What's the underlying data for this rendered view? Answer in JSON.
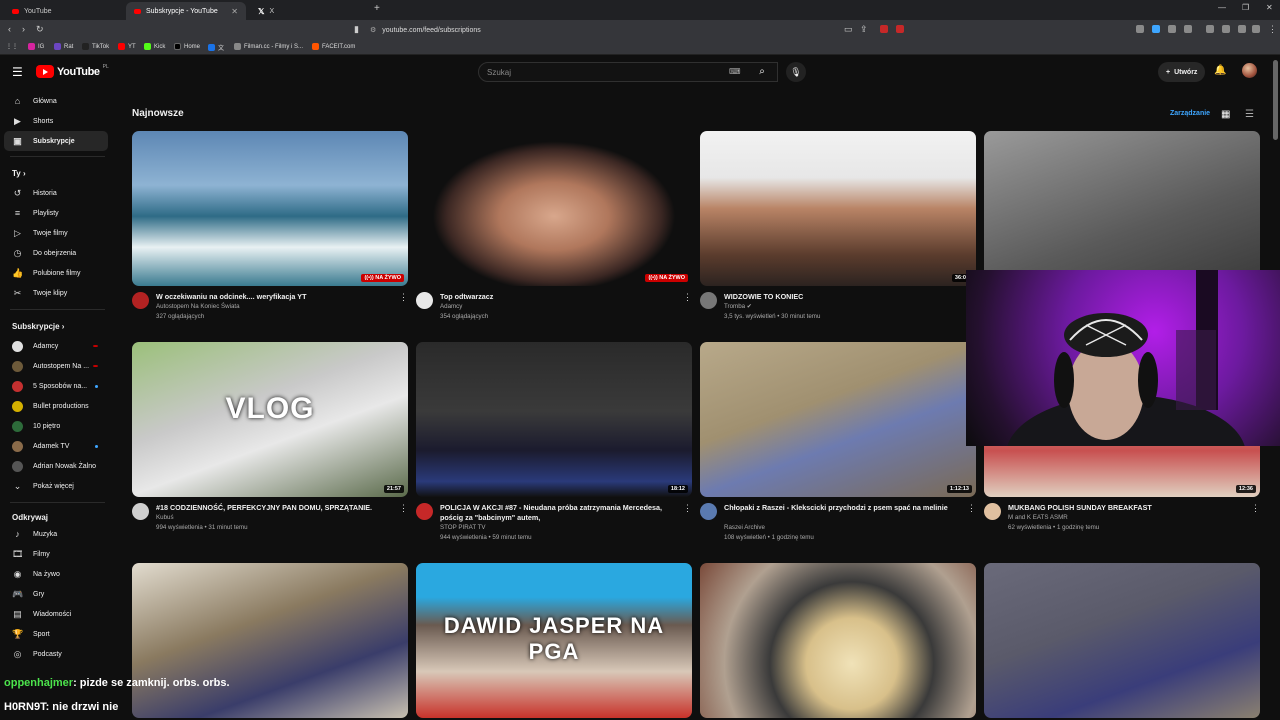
{
  "browser": {
    "tabs": [
      {
        "title": "YouTube",
        "icon": "youtube-icon"
      },
      {
        "title": "Subskrypcje - YouTube",
        "icon": "youtube-icon",
        "active": true
      },
      {
        "title": "X",
        "icon": "x-icon"
      }
    ],
    "url": "youtube.com/feed/subscriptions",
    "bookmarks": [
      {
        "label": "IG",
        "color": "#d6249f"
      },
      {
        "label": "Rat",
        "color": "#6b46c1"
      },
      {
        "label": "TikTok",
        "color": "#111111"
      },
      {
        "label": "YT",
        "color": "#ff0000"
      },
      {
        "label": "Kick",
        "color": "#53fc18"
      },
      {
        "label": "Home",
        "color": "#000000"
      },
      {
        "label": "文",
        "color": "#1a73e8"
      },
      {
        "label": "Filman.cc - Filmy i S...",
        "color": "#888888"
      },
      {
        "label": "FACEIT.com",
        "color": "#ff5500"
      }
    ]
  },
  "header": {
    "logo": "YouTube",
    "logo_country": "PL",
    "search_placeholder": "Szukaj",
    "create_label": "Utwórz"
  },
  "sidebar": {
    "main": [
      {
        "label": "Główna",
        "icon": "home-icon"
      },
      {
        "label": "Shorts",
        "icon": "shorts-icon"
      },
      {
        "label": "Subskrypcje",
        "icon": "subscriptions-icon",
        "active": true
      }
    ],
    "you_header": "Ty",
    "you": [
      {
        "label": "Historia",
        "icon": "history-icon"
      },
      {
        "label": "Playlisty",
        "icon": "playlist-icon"
      },
      {
        "label": "Twoje filmy",
        "icon": "your-videos-icon"
      },
      {
        "label": "Do obejrzenia",
        "icon": "watch-later-icon"
      },
      {
        "label": "Polubione filmy",
        "icon": "like-icon"
      },
      {
        "label": "Twoje klipy",
        "icon": "clips-icon"
      }
    ],
    "subs_header": "Subskrypcje",
    "subs": [
      {
        "label": "Adamcy",
        "color": "#e0e0e0",
        "live": true
      },
      {
        "label": "Autostopem Na ...",
        "color": "#6d5a3a",
        "live": true
      },
      {
        "label": "5 Sposobów na...",
        "color": "#c43030",
        "dot": true
      },
      {
        "label": "Bullet productions",
        "color": "#d4b000"
      },
      {
        "label": "10 piętro",
        "color": "#2d6b3a"
      },
      {
        "label": "Adamek TV",
        "color": "#8a6b4a",
        "dot": true
      },
      {
        "label": "Adrian Nowak Żalno",
        "color": "#555555"
      }
    ],
    "show_more": "Pokaż więcej",
    "explore_header": "Odkrywaj",
    "explore": [
      {
        "label": "Muzyka",
        "icon": "music-icon"
      },
      {
        "label": "Filmy",
        "icon": "film-icon"
      },
      {
        "label": "Na żywo",
        "icon": "live-icon"
      },
      {
        "label": "Gry",
        "icon": "gaming-icon"
      },
      {
        "label": "Wiadomości",
        "icon": "news-icon"
      },
      {
        "label": "Sport",
        "icon": "trophy-icon"
      },
      {
        "label": "Podcasty",
        "icon": "podcast-icon"
      }
    ]
  },
  "main": {
    "section_title": "Najnowsze",
    "manage_label": "Zarządzanie",
    "videos": [
      {
        "title": "W oczekiwaniu na odcinek.... weryfikacja YT",
        "channel": "Autostopem Na Koniec Świata",
        "stats": "327 oglądających",
        "badge": "NA ŻYWO",
        "live": true,
        "thumb": "linear-gradient(180deg,#5d87b4 0%,#8eb3d3 35%,#2e6b86 55%,#e9f1f3 75%,#3a7a8f 100%)",
        "avatar": "#b22222"
      },
      {
        "title": "Top odtwarzacz",
        "channel": "Adamcy",
        "stats": "354 oglądających",
        "badge": "NA ŻYWO",
        "live": true,
        "thumb": "radial-gradient(ellipse at 50% 55%,#d8a78c 0%,#b0775c 28%,#3b2723 55%,#0f0f0f 62%)",
        "avatar": "#e8e8e8"
      },
      {
        "title": "WIDZOWIE TO KONIEC",
        "channel": "Tromba",
        "stats": "3,5 tys. wyświetleń • 30 minut temu",
        "badge": "36:08",
        "verified": true,
        "thumb": "linear-gradient(180deg,#f2f2f2 0%,#e7e7e7 30%,#b98466 50%,#5b3c2d 80%,#2c2320 100%)",
        "avatar": "#777777"
      },
      {
        "title": "",
        "channel": "",
        "stats": "",
        "badge": "",
        "thumb": "linear-gradient(160deg,#9a9a9a,#5a5a5a 60%,#3a3a3a)",
        "avatar": "#444444"
      },
      {
        "title": "#18 CODZIENNOŚĆ, PERFEKCYJNY PAN DOMU, SPRZĄTANIE.",
        "channel": "Kubuś",
        "stats": "994 wyświetlenia • 31 minut temu",
        "badge": "21:57",
        "overlay": "VLOG",
        "thumb": "linear-gradient(160deg,#9bc07a 0%,#c9c9c9 40%,#e8e8e8 60%,#5a6a4a 100%)",
        "avatar": "#cfcfcf"
      },
      {
        "title": "POLICJA W AKCJI #87 - Nieudana próba zatrzymania Mercedesa, pościg za \"babcinym\" autem,",
        "channel": "STOP PIRAT TV",
        "stats": "944 wyświetlenia • 59 minut temu",
        "badge": "18:12",
        "thumb": "linear-gradient(180deg,#2a2a2a 0%,#3a3a3a 45%,#1b1b2e 70%,#2a3a7a 90%,#111 100%)",
        "avatar": "#c62828"
      },
      {
        "title": "Chłopaki z Raszei - Klekscicki przychodzi z psem spać na melinie",
        "channel": "Raszei Archive",
        "stats": "108 wyświetleń • 1 godzinę temu",
        "badge": "1:12:13",
        "thumb": "linear-gradient(160deg,#b8a98a 0%,#a09070 40%,#6d7bb0 60%,#7a6a55 100%)",
        "avatar": "#5a7ab0"
      },
      {
        "title": "MUKBANG POLISH SUNDAY BREAKFAST",
        "channel": "M and K EATS ASMR",
        "stats": "62 wyświetlenia • 1 godzinę temu",
        "badge": "12:36",
        "thumb": "linear-gradient(180deg,#d8c2a0 0%,#e8b0a0 40%,#c85050 70%,#e0d0c0 100%)",
        "avatar": "#e0c0a0"
      },
      {
        "title": "",
        "channel": "",
        "stats": "",
        "badge": "",
        "thumb": "linear-gradient(160deg,#e2dccf 0%,#8a7a60 40%,#3a3d6a 70%,#c8c0b0 100%)",
        "avatar": "#444"
      },
      {
        "title": "",
        "channel": "",
        "stats": "",
        "badge": "",
        "overlay": "DAWID JASPER NA PGA",
        "thumb": "linear-gradient(180deg,#2aa8e0 0%,#2aa8e0 22%,#6a5a50 40%,#d8c8b8 70%,#c8322a 100%)",
        "avatar": "#444"
      },
      {
        "title": "",
        "channel": "",
        "stats": "",
        "badge": "",
        "thumb": "radial-gradient(circle at 55% 65%,#f0e2b8 0%,#d8c08a 25%,#3a3a3a 45%,#b0a090 70%,#7a4a3a 100%)",
        "avatar": "#444"
      },
      {
        "title": "",
        "channel": "",
        "stats": "",
        "badge": "",
        "thumb": "linear-gradient(160deg,#6a6a7a 0%,#5a5a6a 40%,#3a3d7a 70%,#8a8070 100%)",
        "avatar": "#444"
      }
    ]
  },
  "stream": {
    "chat": [
      {
        "user": "oppenhajmer",
        "text": ": pizde se zamknij. orbs. orbs.",
        "user_color": "#4ce44c"
      },
      {
        "user": "H0RN9T",
        "text": ": nie drzwi nie",
        "user_color": "#ffffff"
      }
    ]
  }
}
